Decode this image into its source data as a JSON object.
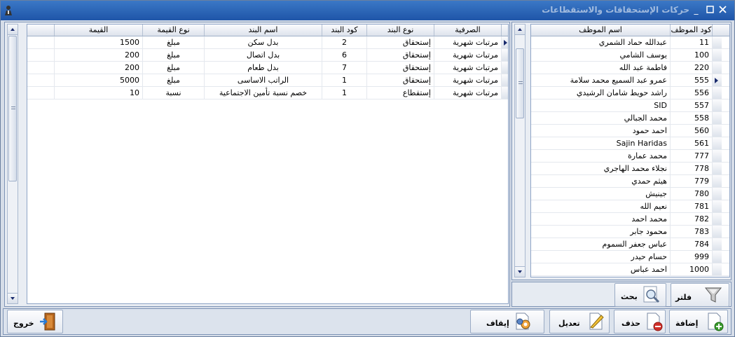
{
  "window": {
    "title": "حركات الإستحقاقات والاستقطاعات"
  },
  "employees": {
    "headers": {
      "code": "كود الموظف",
      "name": "اسم الموظف"
    },
    "rows": [
      {
        "code": "11",
        "name": "عبدالله حماد الشمري"
      },
      {
        "code": "100",
        "name": "يوسف الشامي"
      },
      {
        "code": "220",
        "name": "فاطمة عبد الله"
      },
      {
        "code": "555",
        "name": "عمرو عبد السميع محمد سلامة"
      },
      {
        "code": "556",
        "name": "راشد حويط شامان الرشيدي"
      },
      {
        "code": "557",
        "name": "SID"
      },
      {
        "code": "558",
        "name": "محمد الجبالي"
      },
      {
        "code": "560",
        "name": "احمد حمود"
      },
      {
        "code": "561",
        "name": "Sajin Haridas"
      },
      {
        "code": "777",
        "name": "محمد عمارة"
      },
      {
        "code": "778",
        "name": "نجلاء محمد الهاجري"
      },
      {
        "code": "779",
        "name": "هيثم حمدي"
      },
      {
        "code": "780",
        "name": "جينيش"
      },
      {
        "code": "781",
        "name": "نعيم الله"
      },
      {
        "code": "782",
        "name": "محمد احمد"
      },
      {
        "code": "783",
        "name": "محمود جابر"
      },
      {
        "code": "784",
        "name": "عباس جعفر السموم"
      },
      {
        "code": "999",
        "name": "حسام حيدر"
      },
      {
        "code": "1000",
        "name": "احمد عباس"
      }
    ]
  },
  "items": {
    "headers": {
      "sarf": "الصرفية",
      "type": "نوع البند",
      "code": "كود البند",
      "name": "اسم البند",
      "value_type": "نوع القيمة",
      "value": "القيمة"
    },
    "rows": [
      {
        "sarf": "مرتبات شهرية",
        "type": "إستحقاق",
        "code": "2",
        "name": "بدل سكن",
        "value_type": "مبلغ",
        "value": "1500"
      },
      {
        "sarf": "مرتبات شهرية",
        "type": "إستحقاق",
        "code": "6",
        "name": "بدل اتصال",
        "value_type": "مبلغ",
        "value": "200"
      },
      {
        "sarf": "مرتبات شهرية",
        "type": "إستحقاق",
        "code": "7",
        "name": "بدل طعام",
        "value_type": "مبلغ",
        "value": "200"
      },
      {
        "sarf": "مرتبات شهرية",
        "type": "إستحقاق",
        "code": "1",
        "name": "الراتب الاساسى",
        "value_type": "مبلغ",
        "value": "5000"
      },
      {
        "sarf": "مرتبات شهرية",
        "type": "إستقطاع",
        "code": "1",
        "name": "خصم نسبة تأمين الاجتماعية",
        "value_type": "نسبة",
        "value": "10"
      }
    ]
  },
  "buttons": {
    "filter": "فلتر",
    "search": "بحث",
    "add": "إضافة",
    "delete": "حذف",
    "edit": "تعديل",
    "stop": "إيقاف",
    "exit": "خروج"
  }
}
